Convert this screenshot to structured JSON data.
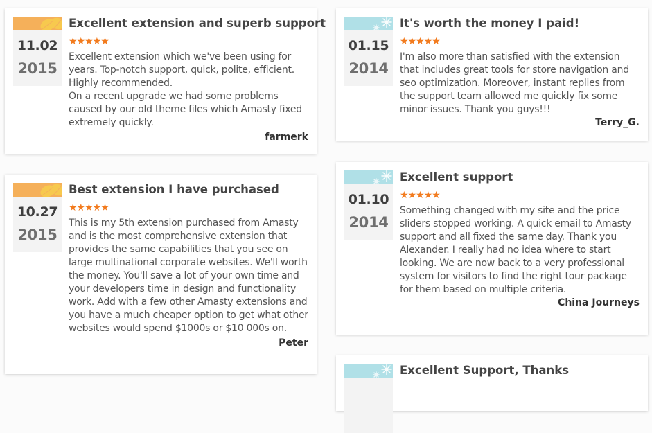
{
  "colors": {
    "autumn_band": "#f5b05a",
    "winter_band": "#b0e0e7",
    "star": "#f27b1e"
  },
  "reviews": [
    {
      "title": "Excellent extension and superb support",
      "date_md": "11.02",
      "date_year": "2015",
      "season": "autumn",
      "season_icon": "leaf-icon",
      "rating": 5,
      "stars": "★★★★★",
      "text": "Excellent extension which we've been using for years. Top-notch support, quick, polite, efficient. Highly recommended.\nOn a recent upgrade we had some problems caused by our old theme files which Amasty fixed extremely quickly.",
      "author": "farmerk"
    },
    {
      "title": "Best extension I have purchased",
      "date_md": "10.27",
      "date_year": "2015",
      "season": "autumn",
      "season_icon": "leaf-icon",
      "rating": 5,
      "stars": "★★★★★",
      "text": "This is my 5th extension purchased from Amasty and is the most comprehensive extension that provides the same capabilities that you see on large multinational corporate websites. We'll worth the money. You'll save a lot of your own time and your developers time in design and functionality work. Add with a few other Amasty extensions and you have a much cheaper option to get what other websites would spend $1000s or $10 000s on.",
      "author": "Peter"
    },
    {
      "title": "It's worth the money I paid!",
      "date_md": "01.15",
      "date_year": "2014",
      "season": "winter",
      "season_icon": "snowflake-icon",
      "rating": 5,
      "stars": "★★★★★",
      "text": "I'm also more than satisfied with the extension that includes great tools for store navigation and seo optimization. Moreover, instant replies from the support team allowed me quickly fix some minor issues. Thank you guys!!!",
      "author": "Terry_G."
    },
    {
      "title": "Excellent support",
      "date_md": "01.10",
      "date_year": "2014",
      "season": "winter",
      "season_icon": "snowflake-icon",
      "rating": 5,
      "stars": "★★★★★",
      "text": "Something changed with my site and the price sliders stopped working. A quick email to Amasty support and all fixed the same day. Thank you Alexander. I really had no idea where to start looking. We are now back to a very professional system for visitors to find the right tour package for them based on multiple criteria.",
      "author": "China Journeys"
    },
    {
      "title": "Excellent Support, Thanks",
      "season": "winter",
      "season_icon": "snowflake-icon"
    }
  ]
}
